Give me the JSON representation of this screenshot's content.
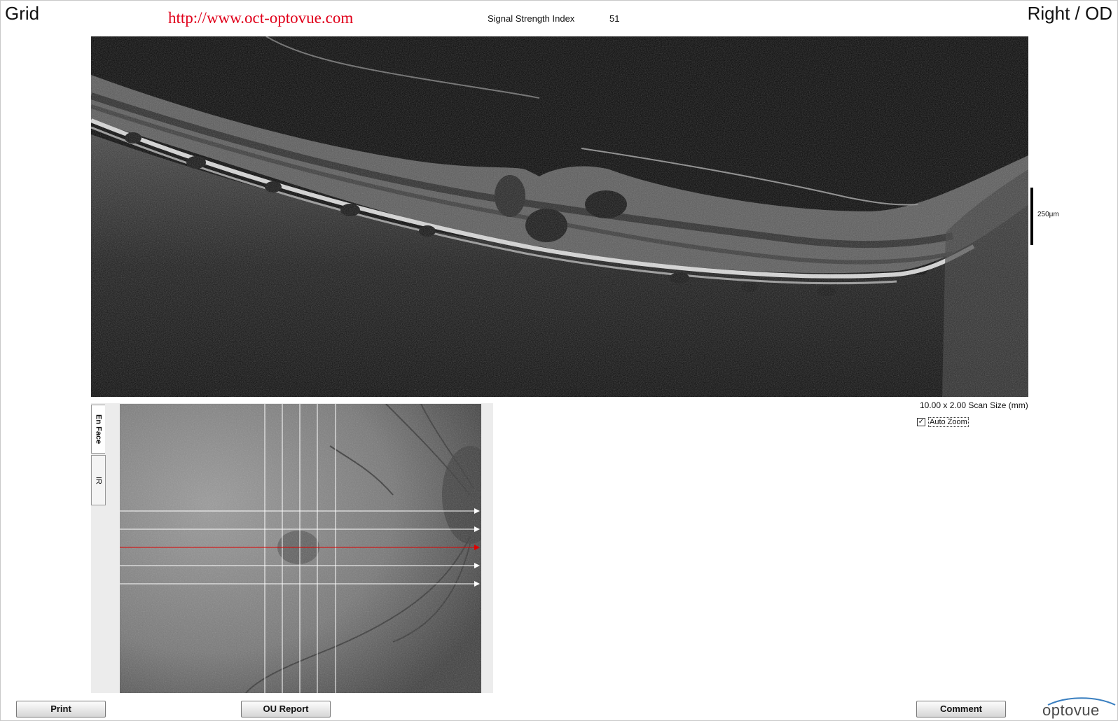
{
  "header": {
    "title": "Grid",
    "url": "http://www.oct-optovue.com",
    "signal_strength_label": "Signal Strength Index",
    "signal_strength_value": "51",
    "eye": "Right / OD"
  },
  "bscan": {
    "scale_label": "250μm",
    "scan_size": "10.00 x 2.00 Scan Size (mm)"
  },
  "auto_zoom": {
    "label": "Auto Zoom",
    "checked": true,
    "check_glyph": "✓"
  },
  "enface": {
    "tabs": [
      {
        "label": "En Face",
        "active": true
      },
      {
        "label": "IR",
        "active": false
      }
    ],
    "horizontal_lines": 5,
    "selected_line": 3,
    "vertical_lines": 5,
    "selected_line_color": "#e00000",
    "line_color": "#ffffff"
  },
  "buttons": {
    "print": "Print",
    "ou_report": "OU Report",
    "comment": "Comment"
  },
  "logo": {
    "text": "optovue",
    "icon": "eye-icon"
  }
}
